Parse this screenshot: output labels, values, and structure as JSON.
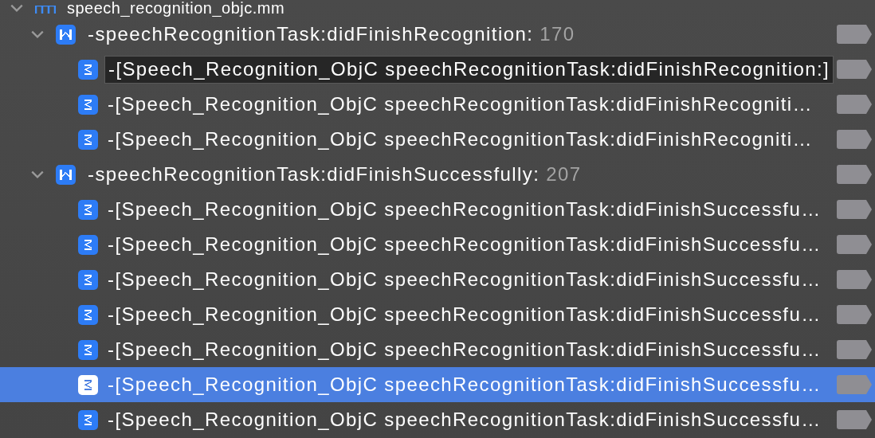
{
  "file": {
    "name": "speech_recognition_objc.mm",
    "expanded": true,
    "methods": [
      {
        "name": "-speechRecognitionTask:didFinishRecognition:",
        "count": "170",
        "expanded": true,
        "calls": [
          {
            "label": "-[Speech_Recognition_ObjC speechRecognitionTask:didFinishRecognition:]",
            "selected": false,
            "hovered": true
          },
          {
            "label": "-[Speech_Recognition_ObjC speechRecognitionTask:didFinishRecogniti…",
            "selected": false,
            "hovered": false
          },
          {
            "label": "-[Speech_Recognition_ObjC speechRecognitionTask:didFinishRecogniti…",
            "selected": false,
            "hovered": false
          }
        ]
      },
      {
        "name": "-speechRecognitionTask:didFinishSuccessfully:",
        "count": "207",
        "expanded": true,
        "calls": [
          {
            "label": "-[Speech_Recognition_ObjC speechRecognitionTask:didFinishSuccessfu…",
            "selected": false,
            "hovered": false
          },
          {
            "label": "-[Speech_Recognition_ObjC speechRecognitionTask:didFinishSuccessfu…",
            "selected": false,
            "hovered": false
          },
          {
            "label": "-[Speech_Recognition_ObjC speechRecognitionTask:didFinishSuccessfu…",
            "selected": false,
            "hovered": false
          },
          {
            "label": "-[Speech_Recognition_ObjC speechRecognitionTask:didFinishSuccessfu…",
            "selected": false,
            "hovered": false
          },
          {
            "label": "-[Speech_Recognition_ObjC speechRecognitionTask:didFinishSuccessfu…",
            "selected": false,
            "hovered": false
          },
          {
            "label": "-[Speech_Recognition_ObjC speechRecognitionTask:didFinishSuccessfu…",
            "selected": true,
            "hovered": false
          },
          {
            "label": "-[Speech_Recognition_ObjC speechRecognitionTask:didFinishSuccessfu…",
            "selected": false,
            "hovered": false
          }
        ]
      }
    ]
  }
}
